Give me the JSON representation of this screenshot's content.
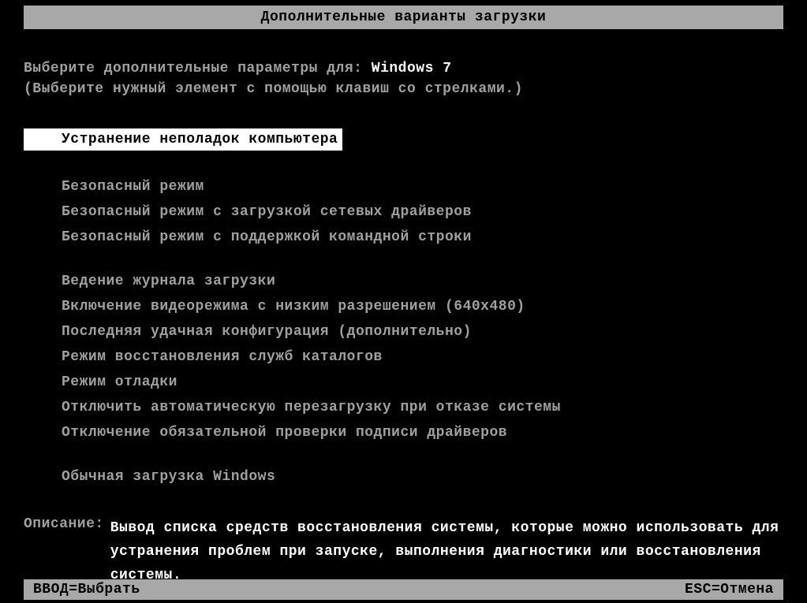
{
  "title": "Дополнительные варианты загрузки",
  "prompt_prefix": "Выберите дополнительные параметры для: ",
  "os_name": "Windows 7",
  "instruction": "(Выберите нужный элемент с помощью клавиш со стрелками.)",
  "menu": {
    "selected_index": 0,
    "items": [
      "Устранение неполадок компьютера",
      "Безопасный режим",
      "Безопасный режим с загрузкой сетевых драйверов",
      "Безопасный режим с поддержкой командной строки",
      "Ведение журнала загрузки",
      "Включение видеорежима с низким разрешением (640x480)",
      "Последняя удачная конфигурация (дополнительно)",
      "Режим восстановления служб каталогов",
      "Режим отладки",
      "Отключить автоматическую перезагрузку при отказе системы",
      "Отключение обязательной проверки подписи драйверов",
      "Обычная загрузка Windows"
    ]
  },
  "description_label": "Описание:",
  "description_text": "Вывод списка средств восстановления системы, которые можно использовать для устранения проблем при запуске, выполнения диагностики или восстановления системы.",
  "footer": {
    "select": "ВВОД=Выбрать",
    "cancel": "ESC=Отмена"
  }
}
